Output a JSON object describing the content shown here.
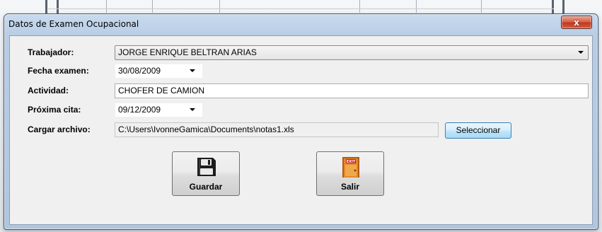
{
  "window": {
    "title": "Datos de Examen Ocupacional",
    "close_label": "x"
  },
  "form": {
    "trabajador_label": "Trabajador:",
    "trabajador_value": "JORGE ENRIQUE BELTRAN ARIAS",
    "fecha_label": "Fecha examen:",
    "fecha_value": "30/08/2009",
    "actividad_label": "Actividad:",
    "actividad_value": "CHOFER DE CAMION",
    "proxima_label": "Próxima cita:",
    "proxima_value": "09/12/2009",
    "archivo_label": "Cargar archivo:",
    "archivo_value": "C:\\Users\\IvonneGamica\\Documents\\notas1.xls",
    "seleccionar_label": "Seleccionar"
  },
  "buttons": {
    "guardar_label": "Guardar",
    "guardar_icon": "floppy-disk-icon",
    "salir_label": "Salir",
    "salir_icon": "exit-door-icon",
    "exit_sign_text": "EXIT"
  },
  "colors": {
    "frame": "#b8cde5",
    "close": "#c2381f",
    "client": "#f0f0f0",
    "select_button": "#bee6fd"
  }
}
